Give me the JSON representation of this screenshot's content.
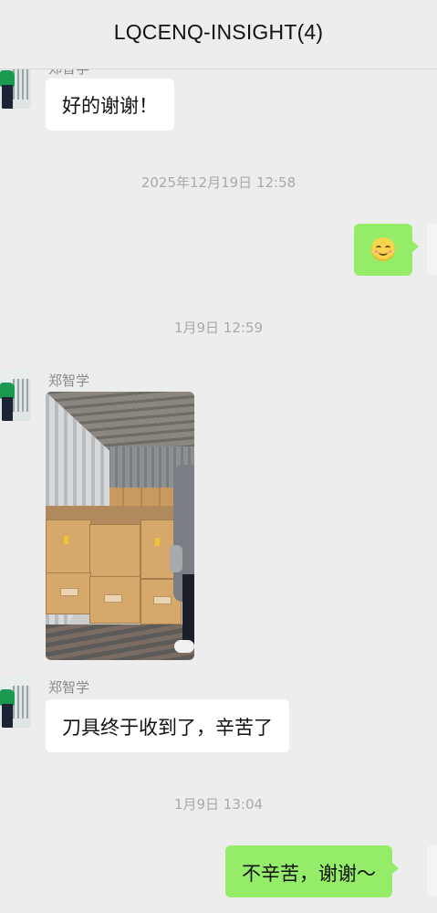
{
  "header": {
    "title": "LQCENQ-INSIGHT(4)"
  },
  "messages": [
    {
      "type": "incoming_text",
      "sender": "郑智学",
      "text": "好的谢谢！"
    },
    {
      "type": "timestamp",
      "text": "2025年12月19日 12:58"
    },
    {
      "type": "outgoing_emoji",
      "emoji": "smiling-face-emoji"
    },
    {
      "type": "timestamp",
      "text": "1月9日 12:59"
    },
    {
      "type": "incoming_image",
      "sender": "郑智学",
      "image": "container-boxes-photo"
    },
    {
      "type": "incoming_text",
      "sender": "郑智学",
      "text": "刀具终于收到了，辛苦了"
    },
    {
      "type": "timestamp",
      "text": "1月9日 13:04"
    },
    {
      "type": "outgoing_text",
      "text": "不辛苦，谢谢～"
    }
  ],
  "colors": {
    "background": "#ededed",
    "incoming_bubble": "#ffffff",
    "outgoing_bubble": "#95ec69",
    "timestamp_text": "#a9a9a9"
  }
}
